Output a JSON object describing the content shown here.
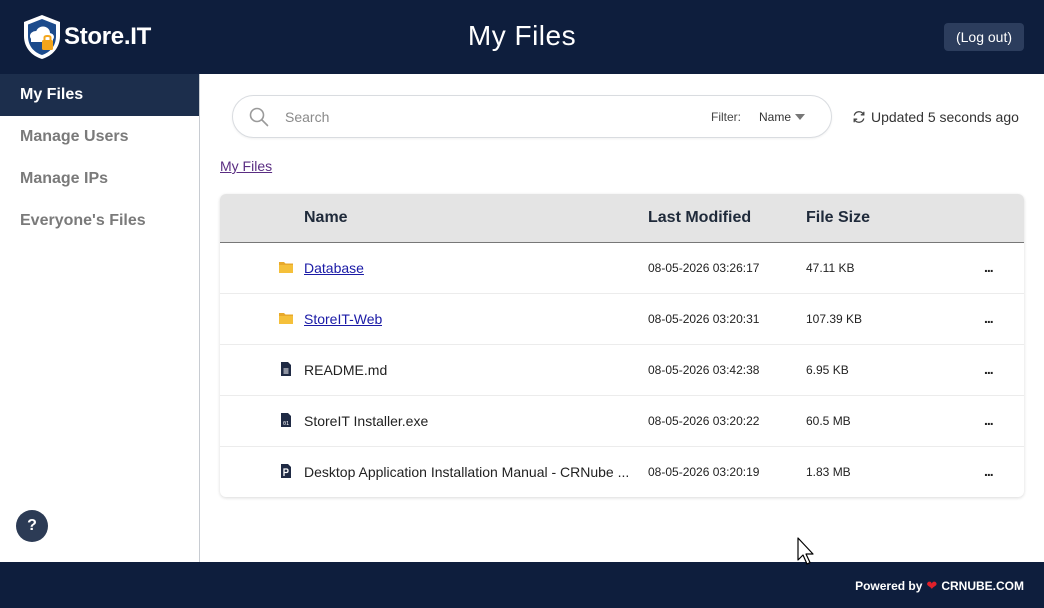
{
  "header": {
    "logo_text": "Store.IT",
    "title": "My Files",
    "logout_label": "(Log out)"
  },
  "sidebar": {
    "items": [
      {
        "label": "My Files",
        "active": true
      },
      {
        "label": "Manage Users",
        "active": false
      },
      {
        "label": "Manage IPs",
        "active": false
      },
      {
        "label": "Everyone's Files",
        "active": false
      }
    ],
    "help_label": "?"
  },
  "search": {
    "placeholder": "Search",
    "value": "",
    "filter_label": "Filter:",
    "filter_value": "Name"
  },
  "status": {
    "updated_text": "Updated 5 seconds ago"
  },
  "breadcrumb": {
    "label": "My Files"
  },
  "table": {
    "columns": {
      "name": "Name",
      "last_modified": "Last Modified",
      "file_size": "File Size"
    },
    "rows": [
      {
        "icon": "folder-icon",
        "name": "Database",
        "modified": "08-05-2026 03:26:17",
        "size": "47.11 KB",
        "more": "..."
      },
      {
        "icon": "folder-icon",
        "name": "StoreIT-Web",
        "modified": "08-05-2026 03:20:31",
        "size": "107.39 KB",
        "more": "..."
      },
      {
        "icon": "document-icon",
        "name": "README.md",
        "modified": "08-05-2026 03:42:38",
        "size": "6.95 KB",
        "more": "..."
      },
      {
        "icon": "binary-file-icon",
        "name": "StoreIT Installer.exe",
        "modified": "08-05-2026 03:20:22",
        "size": "60.5 MB",
        "more": "..."
      },
      {
        "icon": "presentation-file-icon",
        "name": "Desktop Application Installation Manual - CRNube ...",
        "modified": "08-05-2026 03:20:19",
        "size": "1.83 MB",
        "more": "..."
      }
    ]
  },
  "footer": {
    "powered_by": "Powered by",
    "brand": "CRNUBE.COM"
  },
  "colors": {
    "header_bg": "#0e1e3d",
    "sidebar_active_bg": "#1c2e4c",
    "folder_yellow": "#f5c03a",
    "heart_red": "#e0202a"
  }
}
